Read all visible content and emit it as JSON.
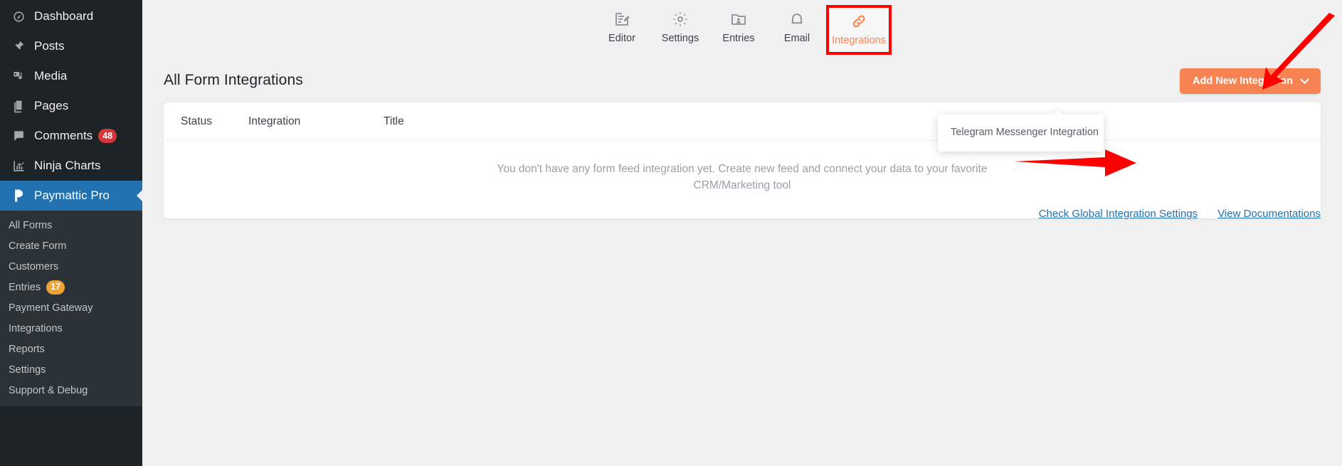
{
  "sidebar": {
    "items": [
      {
        "label": "Dashboard",
        "icon": "dashboard-icon",
        "badge": null,
        "active": false
      },
      {
        "label": "Posts",
        "icon": "pin-icon",
        "badge": null,
        "active": false
      },
      {
        "label": "Media",
        "icon": "media-icon",
        "badge": null,
        "active": false
      },
      {
        "label": "Pages",
        "icon": "pages-icon",
        "badge": null,
        "active": false
      },
      {
        "label": "Comments",
        "icon": "comment-icon",
        "badge": "48",
        "active": false
      },
      {
        "label": "Ninja Charts",
        "icon": "chart-icon",
        "badge": null,
        "active": false
      },
      {
        "label": "Paymattic Pro",
        "icon": "paymattic-icon",
        "badge": null,
        "active": true
      }
    ],
    "submenu": [
      {
        "label": "All Forms",
        "badge": null
      },
      {
        "label": "Create Form",
        "badge": null
      },
      {
        "label": "Customers",
        "badge": null
      },
      {
        "label": "Entries",
        "badge": "17"
      },
      {
        "label": "Payment Gateway",
        "badge": null
      },
      {
        "label": "Integrations",
        "badge": null
      },
      {
        "label": "Reports",
        "badge": null
      },
      {
        "label": "Settings",
        "badge": null
      },
      {
        "label": "Support & Debug",
        "badge": null
      }
    ]
  },
  "tabs": [
    {
      "label": "Editor",
      "icon": "editor-icon",
      "active": false
    },
    {
      "label": "Settings",
      "icon": "gear-icon",
      "active": false
    },
    {
      "label": "Entries",
      "icon": "entries-folder-icon",
      "active": false
    },
    {
      "label": "Email",
      "icon": "bell-icon",
      "active": false
    },
    {
      "label": "Integrations",
      "icon": "link-icon",
      "active": true
    }
  ],
  "page": {
    "title": "All Form Integrations",
    "add_button_label": "Add New Integration"
  },
  "table": {
    "headers": {
      "status": "Status",
      "integration": "Integration",
      "title": "Title"
    },
    "empty_message": "You don't have any form feed integration yet. Create new feed and connect your data to your favorite CRM/Marketing tool"
  },
  "dropdown": {
    "items": [
      {
        "label": "Telegram Messenger Integration"
      }
    ]
  },
  "footer": {
    "links": [
      {
        "label": "Check Global Integration Settings"
      },
      {
        "label": "View Documentations"
      }
    ]
  },
  "colors": {
    "sidebar_bg": "#1d2327",
    "submenu_bg": "#2c3338",
    "active_menu": "#2271b1",
    "accent_orange": "#f78252",
    "highlight_red": "#ff0000",
    "link_blue": "#2271b1",
    "comment_badge": "#d63638",
    "entries_badge": "#f0a335"
  }
}
